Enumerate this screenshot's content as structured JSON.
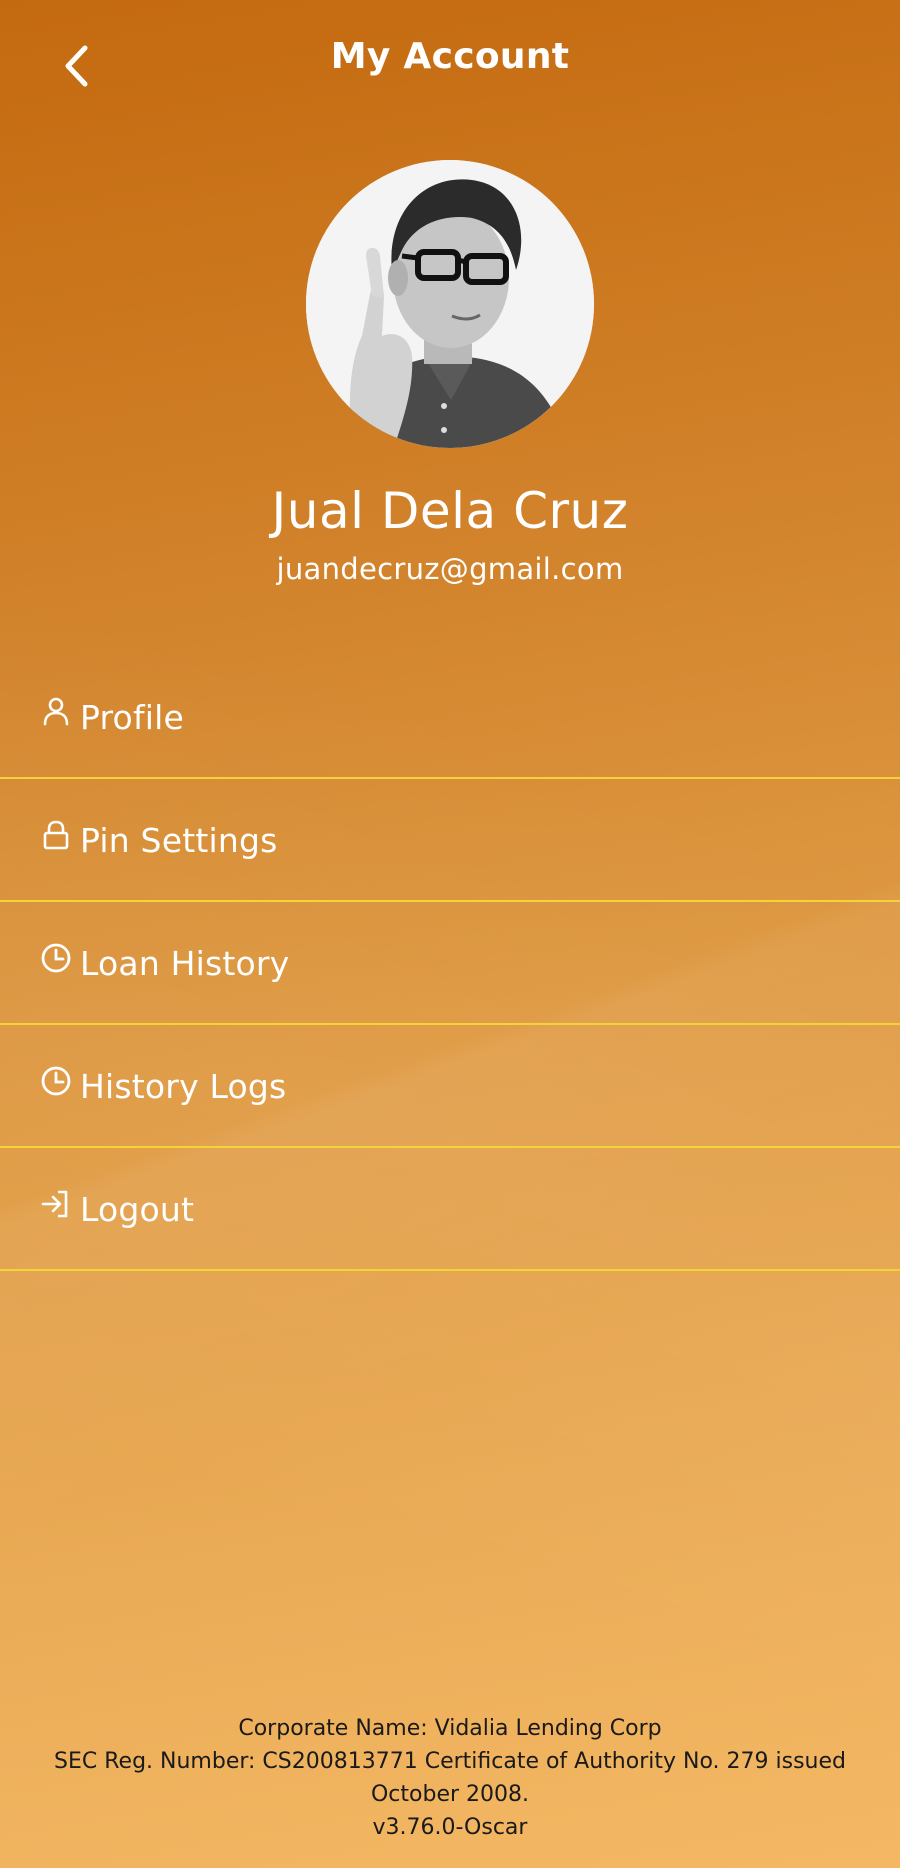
{
  "header": {
    "title": "My Account",
    "back_icon": "chevron-left-icon"
  },
  "user": {
    "name": "Jual Dela Cruz",
    "email": "juandecruz@gmail.com"
  },
  "menu": {
    "items": [
      {
        "label": "Profile",
        "icon": "user-icon"
      },
      {
        "label": "Pin Settings",
        "icon": "lock-icon"
      },
      {
        "label": "Loan History",
        "icon": "clock-icon"
      },
      {
        "label": "History Logs",
        "icon": "clock-icon"
      },
      {
        "label": "Logout",
        "icon": "logout-icon"
      }
    ]
  },
  "footer": {
    "corporate": "Corporate Name: Vidalia Lending Corp",
    "sec": "SEC Reg. Number: CS200813771 Certificate of Authority No. 279 issued October 2008.",
    "version": "v3.76.0-Oscar"
  },
  "colors": {
    "gradient_top": "#c4690f",
    "gradient_bottom": "#f4b864",
    "divider": "#f2d43a",
    "text_light": "#ffffff",
    "text_dark": "#1a1a1a"
  }
}
